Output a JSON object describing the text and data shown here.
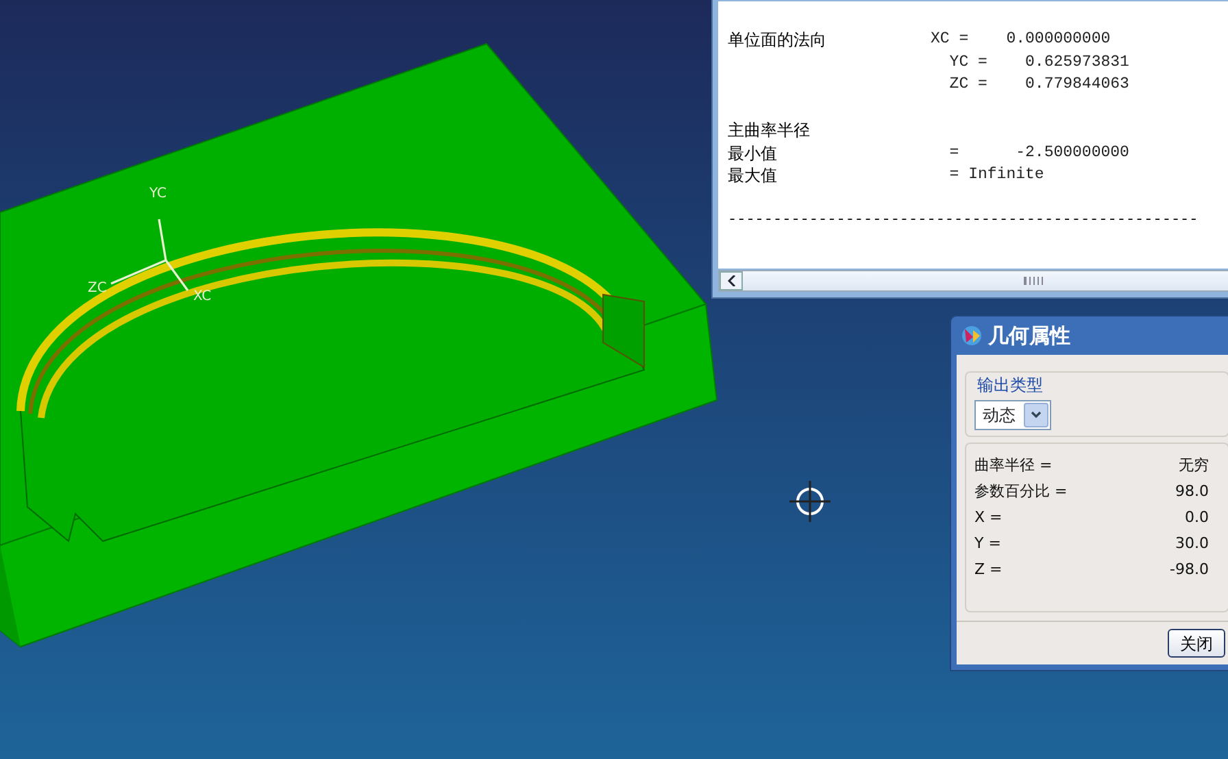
{
  "triad": {
    "labels": [
      "YC",
      "ZC",
      "XC"
    ]
  },
  "info_window": {
    "sections": [
      {
        "lines": [
          {
            "label": "单位面的法向",
            "value": "XC =    0.000000000"
          },
          {
            "value": "  YC =    0.625973831"
          },
          {
            "value": "  ZC =    0.779844063"
          }
        ]
      },
      {
        "lines": [
          {
            "label": "主曲率半径"
          },
          {
            "label": "最小值",
            "value": "  =      -2.500000000"
          },
          {
            "label": "最大值",
            "value": "  = Infinite"
          }
        ]
      }
    ],
    "separator": "----------------------------------------------------"
  },
  "dialog": {
    "title": "几何属性",
    "output_type": {
      "legend": "输出类型",
      "value": "动态"
    },
    "rows": [
      {
        "label": "曲率半径 =",
        "value": "无穷"
      },
      {
        "label": "参数百分比 =",
        "value": "98.0"
      },
      {
        "label": "X =",
        "value": "0.0"
      },
      {
        "label": "Y =",
        "value": "30.0"
      },
      {
        "label": "Z =",
        "value": "-98.0"
      }
    ],
    "close_button": "关闭"
  }
}
